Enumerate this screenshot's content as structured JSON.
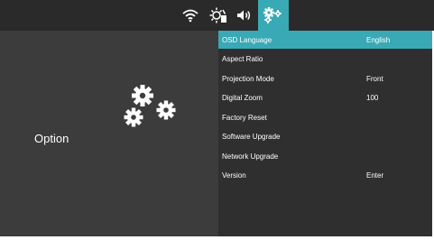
{
  "topbar": {
    "icons": [
      {
        "name": "wifi-icon",
        "active": false
      },
      {
        "name": "image-settings-icon",
        "active": false
      },
      {
        "name": "volume-icon",
        "active": false
      },
      {
        "name": "option-gears-icon",
        "active": true
      }
    ]
  },
  "left_panel": {
    "title": "Option",
    "icon": "gears-icon"
  },
  "menu": {
    "items": [
      {
        "label": "OSD Language",
        "value": "English",
        "selected": true
      },
      {
        "label": "Aspect Ratio",
        "value": ""
      },
      {
        "label": "Projection Mode",
        "value": "Front"
      },
      {
        "label": "Digital Zoom",
        "value": "100"
      },
      {
        "label": "Factory Reset",
        "value": ""
      },
      {
        "label": "Software Upgrade",
        "value": ""
      },
      {
        "label": "Network Upgrade",
        "value": ""
      },
      {
        "label": "Version",
        "value": "Enter"
      }
    ]
  },
  "colors": {
    "accent": "#39a9b5",
    "topbar_bg": "#2a2a2a",
    "left_bg": "#3c3c3c",
    "menu_bg": "#2f2f2f",
    "text": "#ffffff"
  }
}
